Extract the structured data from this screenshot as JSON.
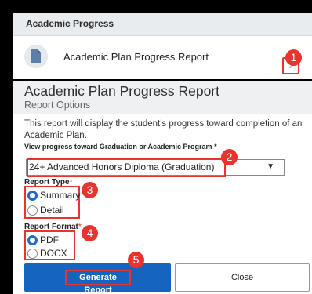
{
  "progress_panel": {
    "header": "Academic Progress",
    "row_title": "Academic Plan Progress Report",
    "chevron": "›"
  },
  "report": {
    "title": "Academic Plan Progress Report",
    "subtitle": "Report Options",
    "description": "This report will display the student's progress toward completion of an Academic Plan.",
    "view_label": "View progress toward Graduation or Academic Program *",
    "program_select": {
      "value": "24+ Advanced Honors Diploma (Graduation)",
      "arrow": "▼"
    },
    "report_type": {
      "label": "Report Type",
      "required": "*",
      "options": [
        "Summary",
        "Detail"
      ],
      "selected": "Summary"
    },
    "report_format": {
      "label": "Report Format",
      "required": "*",
      "options": [
        "PDF",
        "DOCX"
      ],
      "selected": "PDF"
    },
    "generate_button": "Generate Report",
    "close_button": "Close"
  },
  "callouts": [
    "1",
    "2",
    "3",
    "4",
    "5"
  ],
  "colors": {
    "highlight": "#e8332f",
    "primary": "#1565c0",
    "radio": "#1c6ad2"
  },
  "icons": {
    "row_icon": "document-icon",
    "chevron": "chevron-right-icon"
  }
}
